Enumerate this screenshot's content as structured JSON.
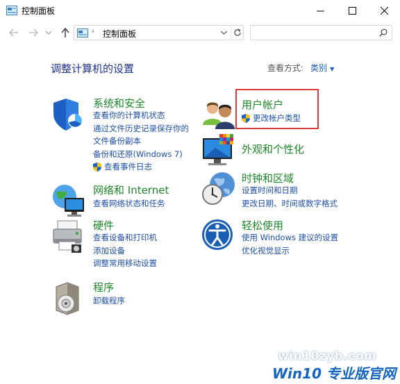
{
  "window": {
    "title": "控制面板",
    "minimize": "—",
    "maximize": "☐",
    "close": "✕"
  },
  "address": {
    "breadcrumb": "控制面板",
    "search_placeholder": ""
  },
  "main": {
    "heading": "调整计算机的设置",
    "view_by_label": "查看方式:",
    "view_by_value": "类别"
  },
  "categories": {
    "system": {
      "title": "系统和安全",
      "links": [
        "查看你的计算机状态",
        "通过文件历史记录保存你的",
        "文件备份副本",
        "备份和还原(Windows 7)",
        "查看事件日志"
      ]
    },
    "network": {
      "title": "网络和 Internet",
      "links": [
        "查看网络状态和任务"
      ]
    },
    "hardware": {
      "title": "硬件",
      "links": [
        "查看设备和打印机",
        "添加设备",
        "调整常用移动设置"
      ]
    },
    "programs": {
      "title": "程序",
      "links": [
        "卸载程序"
      ]
    },
    "accounts": {
      "title": "用户帐户",
      "links": [
        "更改帐户类型"
      ]
    },
    "appearance": {
      "title": "外观和个性化",
      "links": []
    },
    "clock": {
      "title": "时钟和区域",
      "links": [
        "设置时间和日期",
        "更改日期、时间或数字格式"
      ]
    },
    "ease": {
      "title": "轻松使用",
      "links": [
        "使用 Windows 建议的设置",
        "优化视觉显示"
      ]
    }
  },
  "watermark": {
    "site": "win10zyb.com",
    "brand": "Win10 专业版官网"
  },
  "colors": {
    "category_title": "#1e8729",
    "link": "#1d4fa8",
    "heading": "#1e3287",
    "highlight": "#e53935"
  }
}
